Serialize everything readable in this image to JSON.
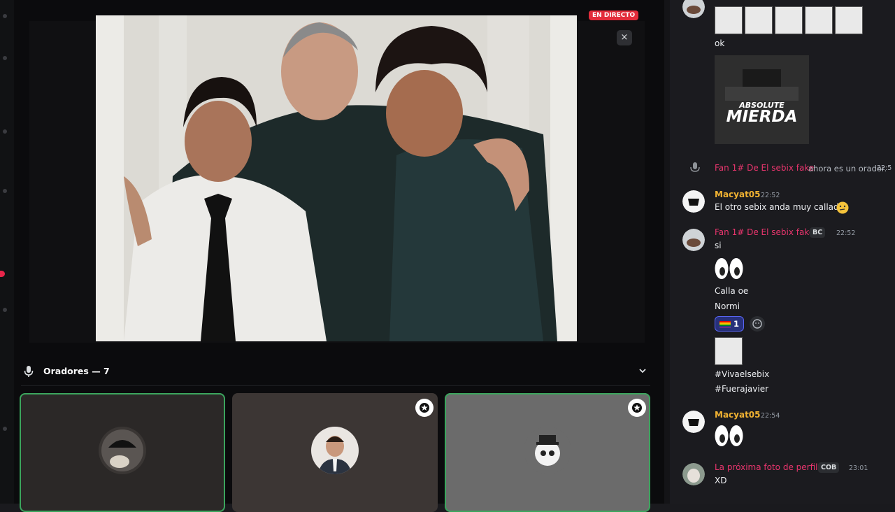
{
  "stage": {
    "live_label": "EN DIRECTO",
    "close_label": "×"
  },
  "speakers": {
    "title": "Oradores — 7"
  },
  "chat": {
    "messages": [
      {
        "text": "ok"
      },
      {
        "sticker": "ABSOLUTE MIERDA"
      },
      {
        "system_user": "Fan 1# De El sebix fake",
        "system_text": "ahora es un orador.",
        "system_time": "22:5"
      },
      {
        "user": "Macyat05",
        "time": "22:52",
        "text": "El otro sebix anda muy callado"
      },
      {
        "user": "Fan 1# De El sebix fake",
        "tag": "BC",
        "time": "22:52",
        "lines": [
          "si",
          "Calla oe",
          "Normi"
        ],
        "reaction_count": "1",
        "hashtags": [
          "#Vivaelsebix",
          "#Fuerajavier"
        ]
      },
      {
        "user": "Macyat05",
        "time": "22:54"
      },
      {
        "user": "La próxima foto de perfil",
        "tag": "COB",
        "time": "23:01",
        "text": "XD"
      }
    ]
  },
  "colors": {
    "username_pink": "#e8356d",
    "username_gold": "#f0b232",
    "live_red": "#e32c3b",
    "speaking_green": "#3ba55d"
  }
}
